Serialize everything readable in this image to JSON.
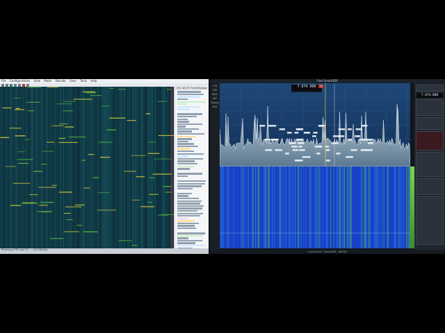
{
  "left": {
    "menu": [
      "File",
      "Configurations",
      "View",
      "Mode",
      "Decode",
      "Save",
      "Tools",
      "Help"
    ],
    "status": "Receiving   FT8   Last Tx: ...   1/15   WD:6m"
  },
  "right": {
    "title": "Flex SmartSDR",
    "freq_main": "7.074 000",
    "freq_side": "7.074.000",
    "bottom_text": "Connected - SmartSDR - 6600M",
    "tx_label": "TX",
    "side_menu": [
      "+RX",
      "FDX",
      "Band",
      "ANT",
      "Display",
      "DAX"
    ]
  },
  "colors": {
    "waterfall_dark": "#0a2530",
    "waterfall_blue": "#1840c8",
    "signal_yellow": "#d6c93a",
    "signal_green": "#58c040",
    "spectrum_bg": "#1a3a66"
  }
}
